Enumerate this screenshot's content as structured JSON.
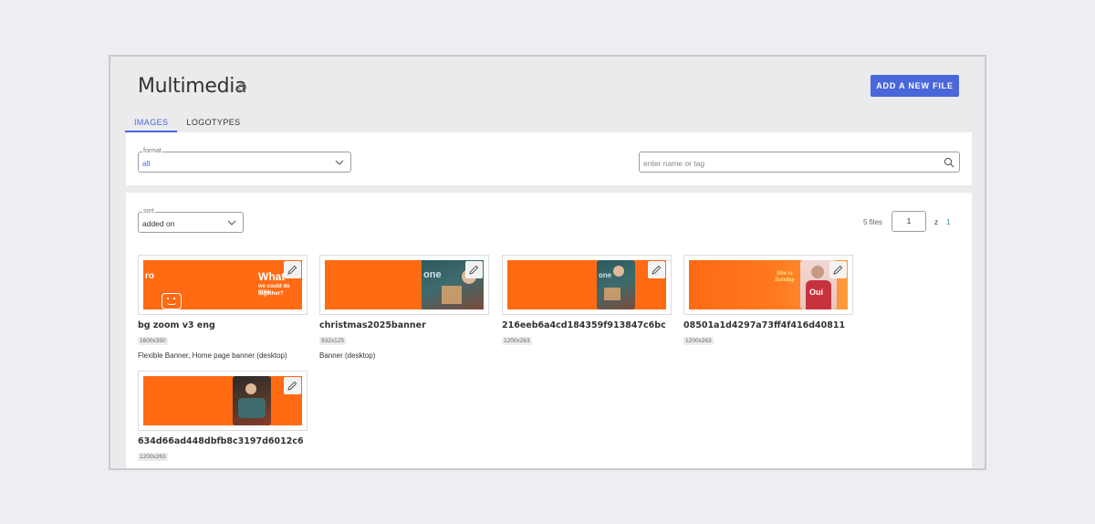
{
  "header": {
    "title": "Multimedia",
    "info_glyph": "i",
    "add_button_label": "ADD A NEW FILE"
  },
  "tabs": [
    {
      "label": "IMAGES",
      "active": true
    },
    {
      "label": "LOGOTYPES",
      "active": false
    }
  ],
  "filters": {
    "format": {
      "legend": "format",
      "value": "all"
    },
    "search": {
      "placeholder": "enter name or tag"
    }
  },
  "sort": {
    "legend": "sort",
    "value": "added on"
  },
  "pagination": {
    "files_count": "5 files",
    "current_page": "1",
    "of_label": "z",
    "total_pages": "1"
  },
  "files": [
    {
      "name": "bg zoom v3 eng",
      "dims": "1600x350",
      "desc": "Flexible Banner, Home page banner (desktop)",
      "thumb_text": [
        "ro",
        "What",
        "we could do grea",
        "together?"
      ]
    },
    {
      "name": "christmas2025banner",
      "dims": "932x125",
      "desc": "Banner (desktop)",
      "thumb_text": [
        "one"
      ]
    },
    {
      "name": "216eeb6a4cd184359f913847c6bc",
      "dims": "1200x263",
      "desc": "",
      "thumb_text": [
        "one"
      ]
    },
    {
      "name": "08501a1d4297a73ff4f416d40811",
      "dims": "1200x263",
      "desc": "",
      "thumb_text": [
        "She is",
        "Sunday",
        "Oui"
      ]
    },
    {
      "name": "634d66ad448dbfb8c3197d6012c6",
      "dims": "1200x263",
      "desc": "",
      "thumb_text": []
    }
  ],
  "colors": {
    "accent": "#4a67d9",
    "banner_orange": "#ff6a13",
    "page_link": "#2a8fa0"
  }
}
